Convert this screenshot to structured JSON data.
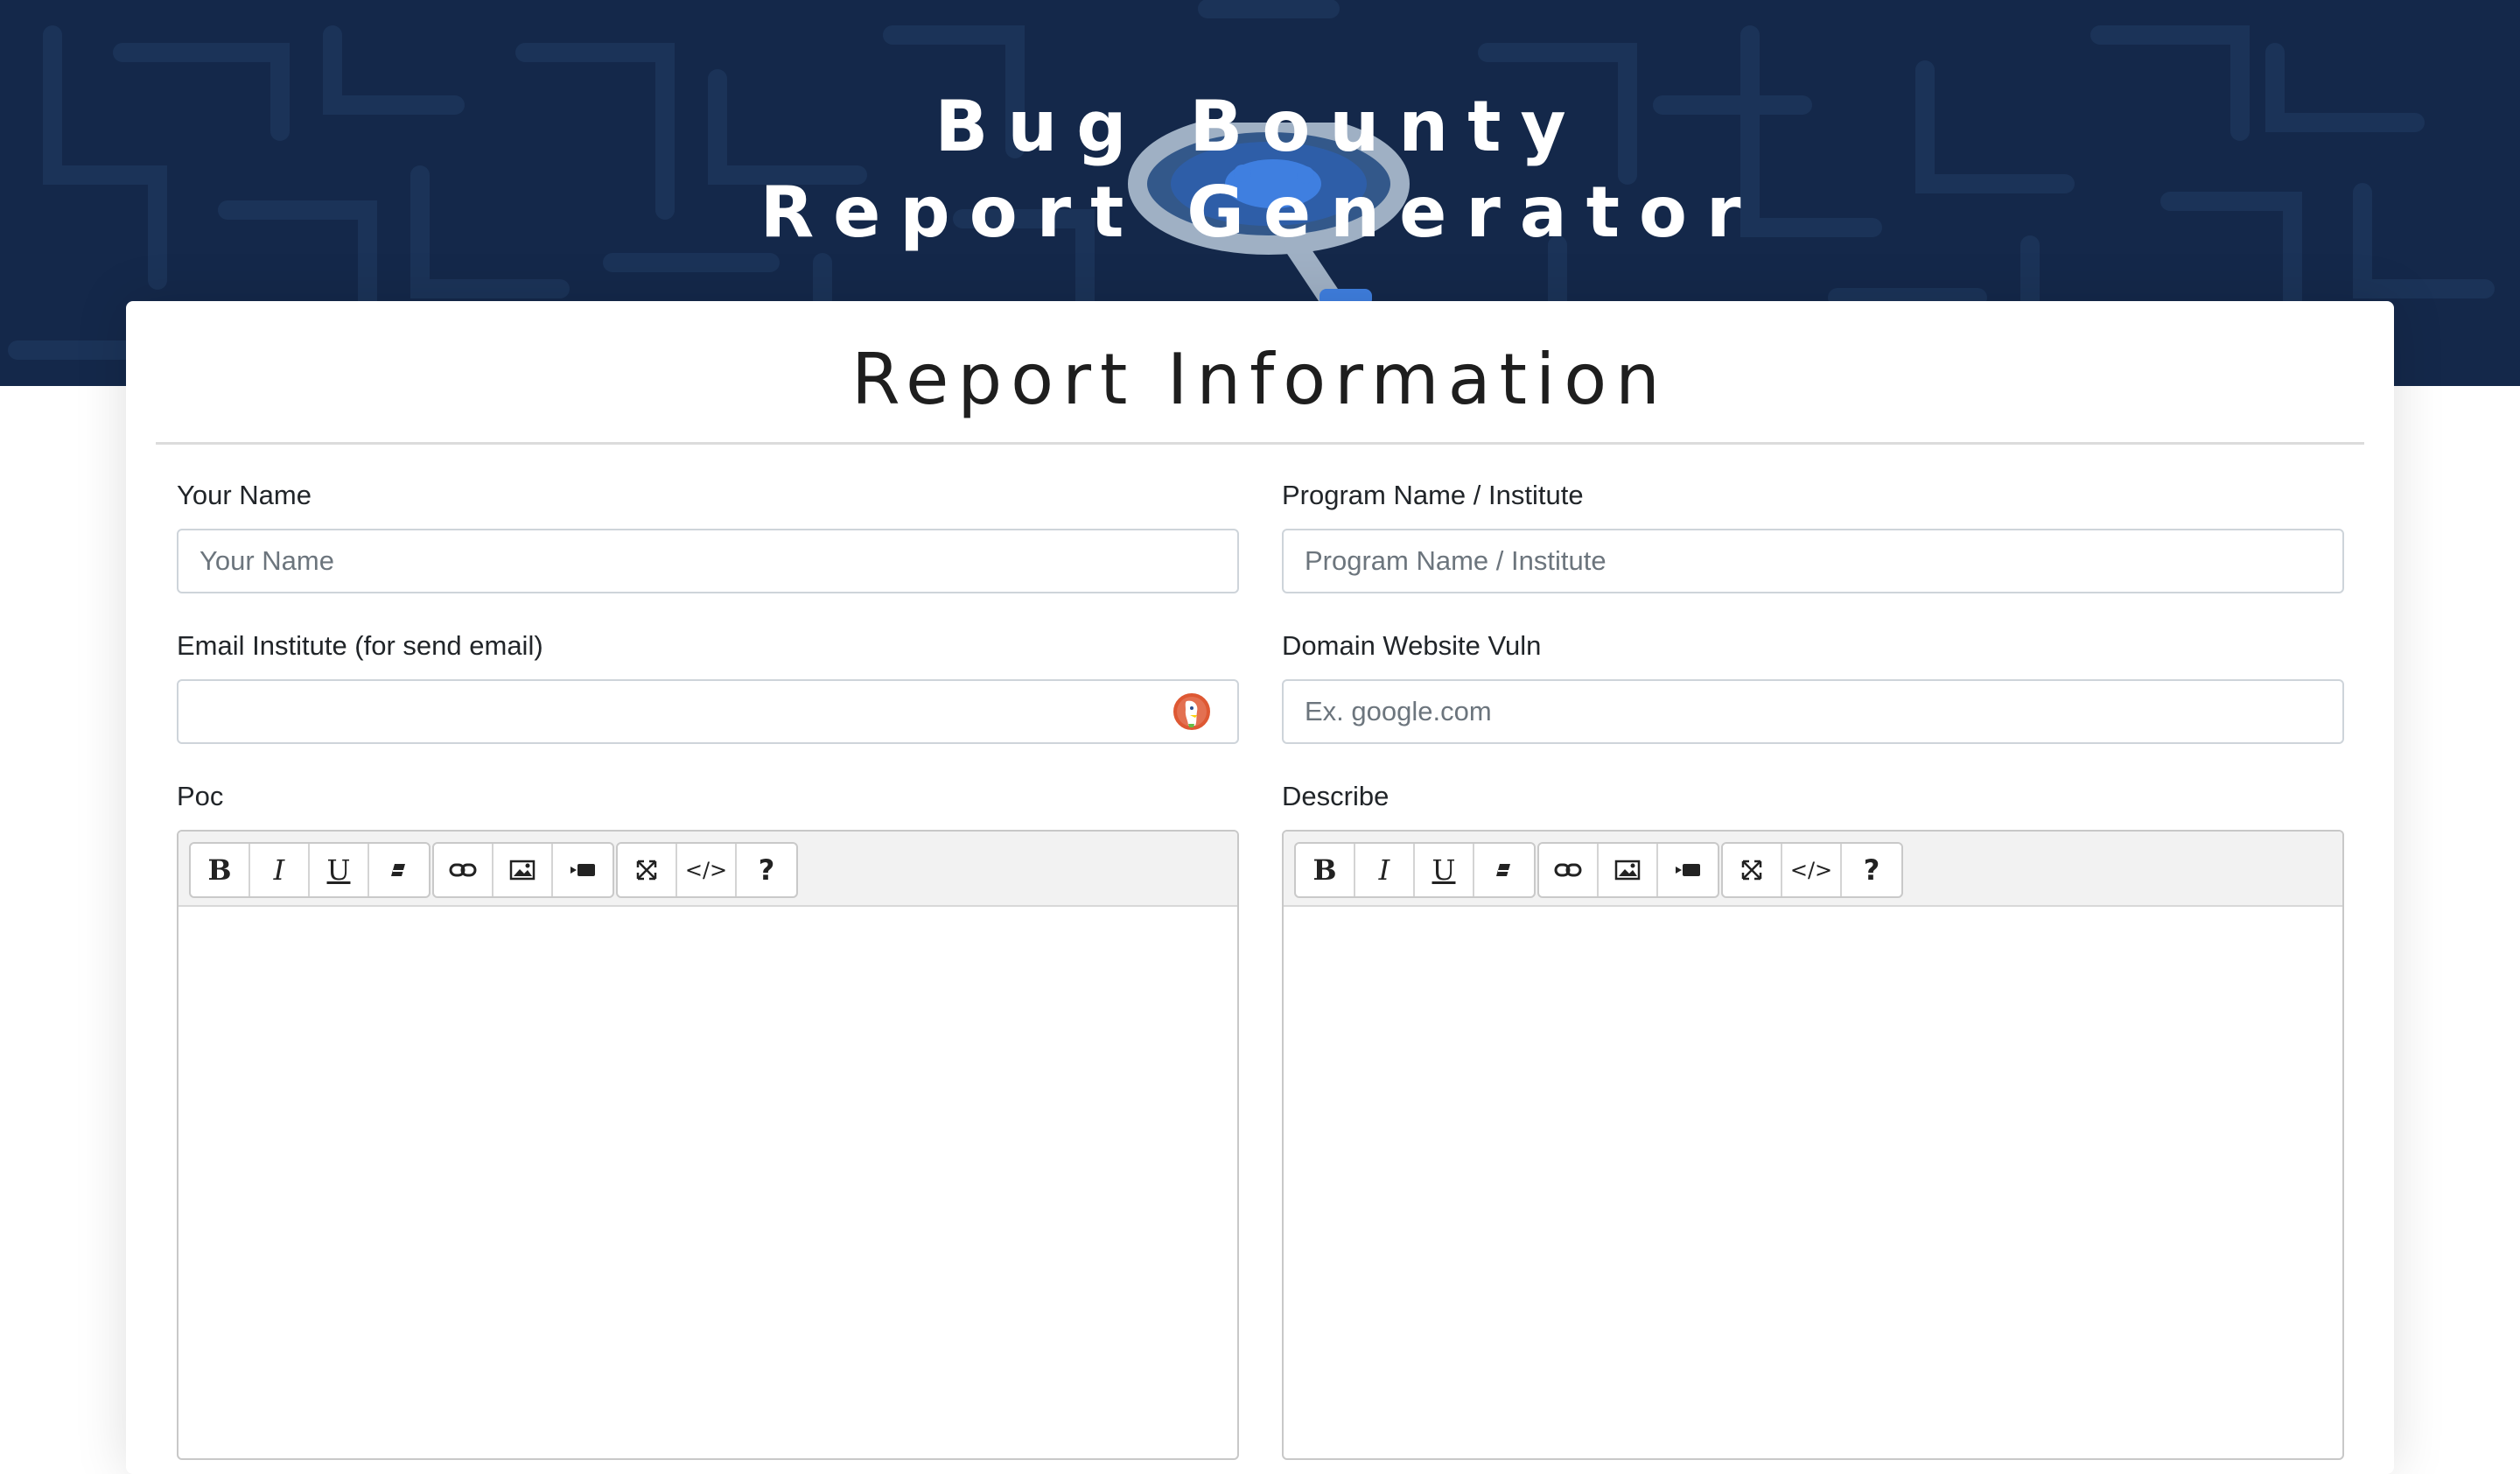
{
  "header": {
    "title_line1": "Bug Bounty",
    "title_line2": "Report Generator",
    "logo_icon": "magnifier-bug-icon",
    "background_color": "#14284a"
  },
  "report": {
    "section_title": "Report Information",
    "fields": {
      "your_name": {
        "label": "Your Name",
        "placeholder": "Your Name",
        "value": ""
      },
      "program_name": {
        "label": "Program Name / Institute",
        "placeholder": "Program Name / Institute",
        "value": ""
      },
      "email_institute": {
        "label": "Email Institute (for send email)",
        "placeholder": "",
        "value": "",
        "icon": "duckduckgo-icon"
      },
      "domain": {
        "label": "Domain Website Vuln",
        "placeholder": "Ex. google.com",
        "value": ""
      }
    },
    "editors": {
      "poc": {
        "label": "Poc"
      },
      "describe": {
        "label": "Describe"
      }
    },
    "toolbar": {
      "bold": "B",
      "italic": "I",
      "underline": "U",
      "code": "</>",
      "help": "?",
      "icons": [
        "bold-icon",
        "italic-icon",
        "underline-icon",
        "eraser-icon",
        "link-icon",
        "picture-icon",
        "video-icon",
        "fullscreen-icon",
        "code-view-icon",
        "help-icon"
      ]
    }
  }
}
